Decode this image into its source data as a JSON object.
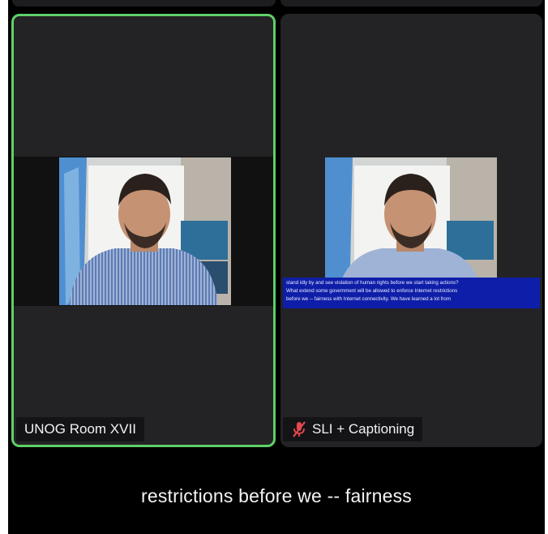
{
  "participants": [
    {
      "name": "UNOG Room XVII",
      "muted": false,
      "active_speaker": true
    },
    {
      "name": "SLI + Captioning",
      "muted": true,
      "active_speaker": false
    }
  ],
  "sign_language_captions": [
    "stand idly by and see violation of human rights before we start taking actions?",
    "What extend some government will be allowed to enforce Internet restrictions",
    "before we -- fairness with Internet connectivity. We have learned a lot from"
  ],
  "live_caption": "restrictions before we -- fairness",
  "colors": {
    "active_border": "#5fd068",
    "muted_icon": "#e5484d",
    "caption_bg": "#0f1ea8"
  }
}
